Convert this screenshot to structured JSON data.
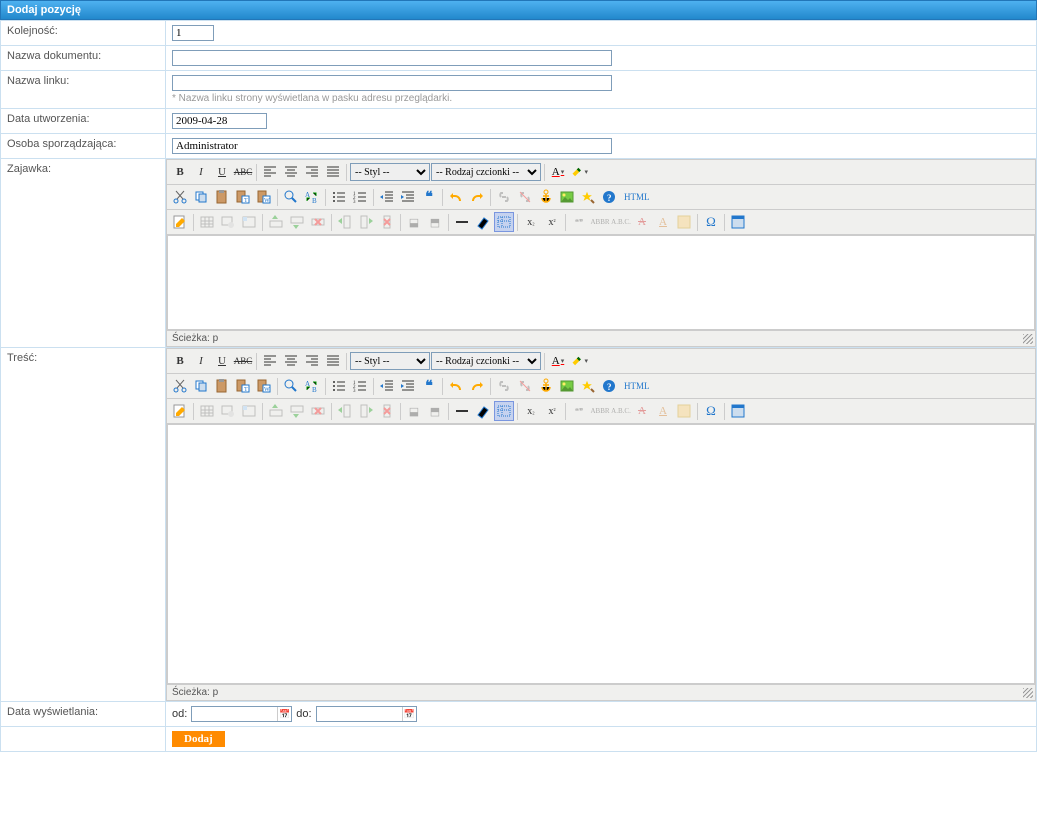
{
  "header": {
    "title": "Dodaj pozycję"
  },
  "fields": {
    "kolejnosc": {
      "label": "Kolejność:",
      "value": "1"
    },
    "nazwa_dokumentu": {
      "label": "Nazwa dokumentu:",
      "value": ""
    },
    "nazwa_linku": {
      "label": "Nazwa linku:",
      "value": "",
      "hint": "* Nazwa linku strony wyświetlana w pasku adresu przeglądarki."
    },
    "data_utworzenia": {
      "label": "Data utworzenia:",
      "value": "2009-04-28"
    },
    "osoba": {
      "label": "Osoba sporządzająca:",
      "value": "Administrator"
    },
    "zajawka": {
      "label": "Zajawka:"
    },
    "tresc": {
      "label": "Treść:"
    },
    "data_wyswietlania": {
      "label": "Data wyświetlania:",
      "od_label": "od:",
      "do_label": "do:",
      "od_value": "",
      "do_value": ""
    }
  },
  "editor": {
    "style_select": "-- Styl --",
    "font_select": "-- Rodzaj czcionki --",
    "path": "Ścieżka: p",
    "html_label": "HTML"
  },
  "submit": {
    "label": "Dodaj"
  }
}
